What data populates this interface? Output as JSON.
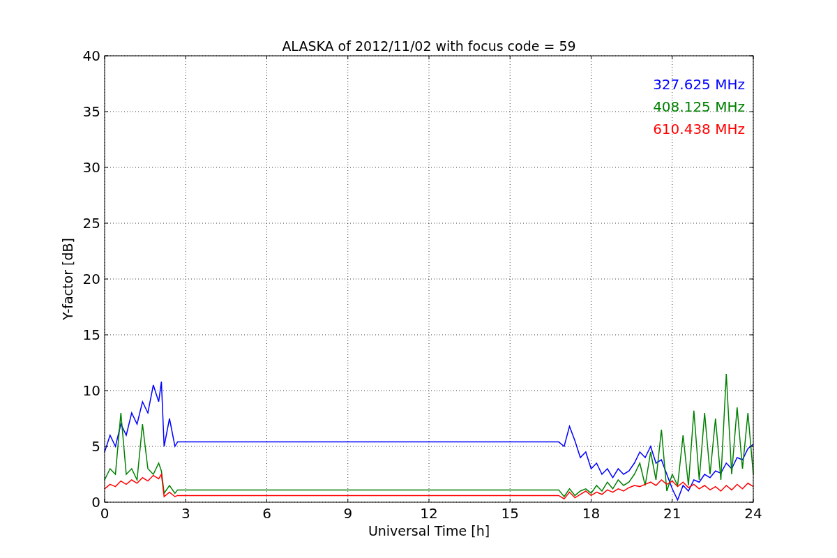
{
  "chart_data": {
    "type": "line",
    "title": "ALASKA of 2012/11/02 with focus code = 59",
    "xlabel": "Universal Time [h]",
    "ylabel": "Y-factor [dB]",
    "x": [
      0,
      0.2,
      0.4,
      0.6,
      0.8,
      1.0,
      1.2,
      1.4,
      1.6,
      1.8,
      2.0,
      2.1,
      2.2,
      2.4,
      2.6,
      2.7,
      16.8,
      17.0,
      17.2,
      17.4,
      17.6,
      17.8,
      18.0,
      18.2,
      18.4,
      18.6,
      18.8,
      19.0,
      19.2,
      19.4,
      19.6,
      19.8,
      20.0,
      20.2,
      20.4,
      20.6,
      20.8,
      21.0,
      21.2,
      21.4,
      21.6,
      21.8,
      22.0,
      22.2,
      22.4,
      22.6,
      22.8,
      23.0,
      23.2,
      23.4,
      23.6,
      23.8,
      24.0
    ],
    "series": [
      {
        "name": "327.625 MHz",
        "color": "#0000ff",
        "values": [
          4.5,
          6,
          5,
          7,
          6,
          8,
          7,
          9,
          8,
          10.5,
          9,
          10.8,
          5,
          7.5,
          5,
          5.4,
          5.4,
          5,
          6.8,
          5.5,
          4,
          4.5,
          3,
          3.5,
          2.5,
          3,
          2.2,
          3,
          2.5,
          2.8,
          3.5,
          4.5,
          4,
          5,
          3.5,
          3.8,
          2.5,
          1.2,
          0.2,
          1.5,
          1,
          2,
          1.8,
          2.5,
          2.2,
          2.8,
          2.6,
          3.5,
          3,
          4,
          3.8,
          4.8,
          5.2
        ]
      },
      {
        "name": "408.125 MHz",
        "color": "#008000",
        "values": [
          2,
          3,
          2.5,
          8,
          2.5,
          3,
          2,
          7,
          3,
          2.5,
          3.5,
          2.8,
          0.8,
          1.5,
          0.8,
          1.1,
          1.1,
          0.5,
          1.2,
          0.6,
          1,
          1.2,
          0.8,
          1.5,
          1,
          1.8,
          1.2,
          2,
          1.5,
          1.8,
          2.5,
          3.5,
          1.5,
          4.5,
          2,
          6.5,
          1,
          2.5,
          1.5,
          6,
          1.5,
          8.2,
          2,
          8,
          2.5,
          7.5,
          2,
          11.5,
          2.5,
          8.5,
          3,
          8,
          2.5
        ]
      },
      {
        "name": "610.438 MHz",
        "color": "#ff0000",
        "values": [
          1.2,
          1.6,
          1.4,
          1.9,
          1.6,
          2,
          1.7,
          2.2,
          1.9,
          2.4,
          2.1,
          2.5,
          0.5,
          0.9,
          0.5,
          0.6,
          0.6,
          0.3,
          0.9,
          0.4,
          0.7,
          1,
          0.6,
          0.9,
          0.7,
          1.1,
          0.9,
          1.2,
          1,
          1.3,
          1.5,
          1.4,
          1.6,
          1.8,
          1.5,
          2,
          1.6,
          1.9,
          1.4,
          1.8,
          1.3,
          1.6,
          1.2,
          1.5,
          1.1,
          1.4,
          1.0,
          1.5,
          1.1,
          1.6,
          1.2,
          1.7,
          1.4
        ]
      }
    ],
    "xlim": [
      0,
      24
    ],
    "ylim": [
      0,
      40
    ],
    "xticks": [
      0,
      3,
      6,
      9,
      12,
      15,
      18,
      21,
      24
    ],
    "yticks": [
      0,
      5,
      10,
      15,
      20,
      25,
      30,
      35,
      40
    ],
    "grid": true
  }
}
